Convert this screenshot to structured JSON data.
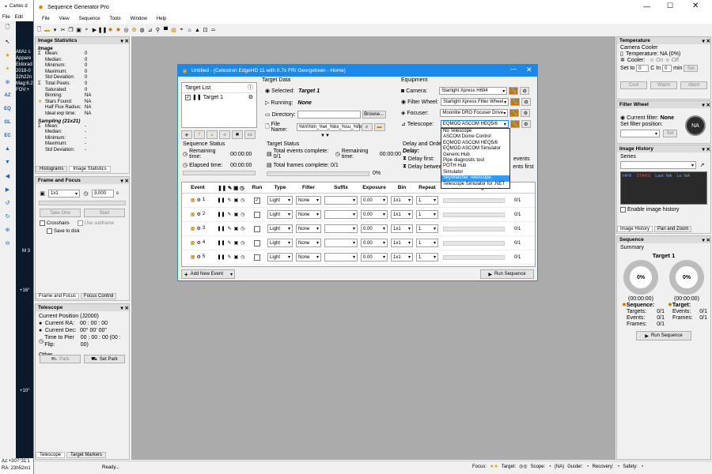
{
  "bg_window": {
    "title": "Cartes d",
    "menu": [
      "File",
      "Edit"
    ],
    "overlay_lines": [
      "AltAz c",
      "Appare",
      "Eldorad",
      "2018-0",
      "22h22n",
      "Mag:6.2",
      "FOV:+"
    ],
    "label_m": "M 3",
    "label_16": "+16°",
    "label_deg": "+10°",
    "status_line1": "Az:+307°31'1",
    "status_line2": "RA: 23h52m1"
  },
  "main_window": {
    "title": "Sequence Generator Pro",
    "menu": [
      "File",
      "View",
      "Sequence",
      "Tools",
      "Window",
      "Help"
    ],
    "status": "Ready...",
    "status_items": {
      "focus": "Focus:",
      "target": "Target:",
      "scope": "Scope:",
      "scope_val": "(NA)",
      "guider": "Guider:",
      "recovery": "Recovery:",
      "safety": "Safety:"
    }
  },
  "image_stats": {
    "title": "Image Statistics",
    "image_hdr": "Image",
    "rows": [
      [
        "Mean:",
        "0"
      ],
      [
        "Median:",
        "0"
      ],
      [
        "Minimum:",
        "0"
      ],
      [
        "Maximum:",
        "0"
      ],
      [
        "Std Deviation:",
        "0"
      ],
      [
        "Total Pixels:",
        "0"
      ],
      [
        "Saturated:",
        "0"
      ],
      [
        "Binning:",
        "NA"
      ],
      [
        "Stars Found:",
        "NA"
      ],
      [
        "Half Flux Radius:",
        "NA"
      ],
      [
        "Ideal exp time:",
        "NA"
      ]
    ],
    "sampling_hdr": "Sampling (21x21)",
    "sampling_rows": [
      [
        "Mean:",
        "-"
      ],
      [
        "Median:",
        "-"
      ],
      [
        "Minimum:",
        "-"
      ],
      [
        "Maximum:",
        "-"
      ],
      [
        "Std Deviation:",
        "-"
      ]
    ],
    "tabs": [
      "Histograms",
      "Image Statistics"
    ]
  },
  "frame_focus": {
    "title": "Frame and Focus",
    "bin": "1x1",
    "exposure": "3.000",
    "s": "s",
    "take_one": "Take One",
    "start": "Start",
    "crosshairs": "Crosshairs",
    "use_subframe": "Use subframe",
    "save_to_disk": "Save to disk",
    "tabs": [
      "Frame and Focus",
      "Focus Control"
    ]
  },
  "telescope": {
    "title": "Telescope",
    "current_pos": "Current Position (J2000)",
    "ra_lbl": "Current RA:",
    "ra_val": "00 : 00 : 00",
    "dec_lbl": "Current Dec:",
    "dec_val": "00° 00' 00\"",
    "pier_lbl": "Time to Pier Flip:",
    "pier_val": "00 : 00 : 00 (00 : 00)",
    "other": "Other",
    "park": "Park",
    "set_park": "Set Park",
    "tabs": [
      "Telescope",
      "Target Markers"
    ]
  },
  "temperature": {
    "title": "Temperature",
    "camera_cooler": "Camera Cooler",
    "temp": "Temperature: NA (0%)",
    "cooler": "Cooler:",
    "on": "On",
    "off": "Off",
    "set_to": "Set to",
    "set_val": "0",
    "c": "C In",
    "in_val": "0",
    "min": "min",
    "set": "Set",
    "cool": "Cool",
    "warm": "Warm",
    "abort": "Abort"
  },
  "filter_wheel": {
    "title": "Filter Wheel",
    "current_lbl": "Current filter:",
    "current_val": "None",
    "set_pos": "Set filter position:",
    "set": "Set",
    "badge": "NA"
  },
  "image_history": {
    "title": "Image History",
    "series": "Series",
    "cols": [
      "HFR",
      "STARS",
      "Last: NA",
      "Lo: NA"
    ],
    "enable": "Enable image history",
    "tabs": [
      "Image History",
      "Pan and Zoom"
    ]
  },
  "sequence_panel": {
    "title": "Sequence",
    "summary": "Summary",
    "target": "Target 1",
    "pct1": "0%",
    "pct2": "0%",
    "time1": "(00:00:00)",
    "time2": "(00:00:00)",
    "seq_hdr": "Sequence:",
    "tgt_hdr": "Target:",
    "targets_lbl": "Targets:",
    "targets_val": "0/1",
    "events_lbl": "Events:",
    "events_val": "0/1",
    "frames_lbl": "Frames:",
    "frames_val": "0/1",
    "t_events_lbl": "Events:",
    "t_events_val": "0/1",
    "t_frames_lbl": "Frames:",
    "t_frames_val": "0/1",
    "run": "Run Sequence"
  },
  "dialog": {
    "title": "Untitled - (Celestron EdgeHD 11 with 0.7x FR/ Georgetown - Home)",
    "target_list": "Target List",
    "target1": "Target 1",
    "target_data": "Target Data",
    "selected_lbl": "Selected:",
    "selected_val": "Target 1",
    "running_lbl": "Running:",
    "running_val": "None",
    "directory_lbl": "Directory:",
    "browse": "Browse...",
    "filename_lbl": "File Name:",
    "filename_val": "%tn\\%tn_%el_%bx_%su_%fe",
    "equipment": "Equipment",
    "camera_lbl": "Camera:",
    "camera_val": "Starlight Xpress H694",
    "fw_lbl": "Filter Wheel:",
    "fw_val": "Starlight Xpress Filter Wheel",
    "focuser_lbl": "Focuser:",
    "focuser_val": "Moonlite DRO Focuser Drive",
    "tele_lbl": "Telescope:",
    "tele_val": "EQMOD ASCOM HEQ5/6",
    "tele_options": [
      "No Telescope",
      "ASCOM Dome Control",
      "EQMOD ASCOM HEQ5/6",
      "EQMOD ASCOM Simulator",
      "Generic Hub",
      "Pipe diagnostic tool",
      "POTH Hub",
      "Simulator",
      "SkyWatcher Telescope",
      "Telescope Simulator for .NET"
    ],
    "seq_status": "Sequence Status",
    "remaining_lbl": "Remaining time:",
    "remaining_val": "00:00:00",
    "elapsed_lbl": "Elapsed time:",
    "elapsed_val": "00:00:00",
    "target_status": "Target Status",
    "total_events": "Total events complete: 0/1",
    "remaining2_lbl": "Remaining time:",
    "remaining2_val": "00:00:00",
    "total_frames": "Total frames complete: 0/1",
    "pct": "0%",
    "delay_hdr": "Delay and Orders",
    "delay_lbl": "Delay:",
    "delay_first": "Delay first:",
    "delay_between": "Delay between:",
    "events_suffix": "events",
    "events_suffix2": "ents first",
    "table_headers": [
      "Event",
      "",
      "Run",
      "Type",
      "Filter",
      "Suffix",
      "Exposure",
      "Bin",
      "Repeat",
      "Progress"
    ],
    "rows": [
      {
        "n": "1",
        "run": true,
        "type": "Light",
        "filter": "None",
        "suffix": "",
        "exp": "0.00",
        "bin": "1x1",
        "rep": "1",
        "prog": "0/1"
      },
      {
        "n": "2",
        "run": false,
        "type": "Light",
        "filter": "None",
        "suffix": "",
        "exp": "0.00",
        "bin": "1x1",
        "rep": "1",
        "prog": "0/1"
      },
      {
        "n": "3",
        "run": false,
        "type": "Light",
        "filter": "None",
        "suffix": "",
        "exp": "0.00",
        "bin": "1x1",
        "rep": "1",
        "prog": "0/1"
      },
      {
        "n": "4",
        "run": false,
        "type": "Light",
        "filter": "None",
        "suffix": "",
        "exp": "0.00",
        "bin": "1x1",
        "rep": "1",
        "prog": "0/1"
      },
      {
        "n": "5",
        "run": false,
        "type": "Light",
        "filter": "None",
        "suffix": "",
        "exp": "0.00",
        "bin": "1x1",
        "rep": "1",
        "prog": "0/1"
      }
    ],
    "add_event": "Add New Event",
    "run_sequence": "Run Sequence"
  },
  "colors": {
    "accent": "#1e88e5",
    "sky": "#0b1a2a",
    "selection": "#3399ff"
  }
}
